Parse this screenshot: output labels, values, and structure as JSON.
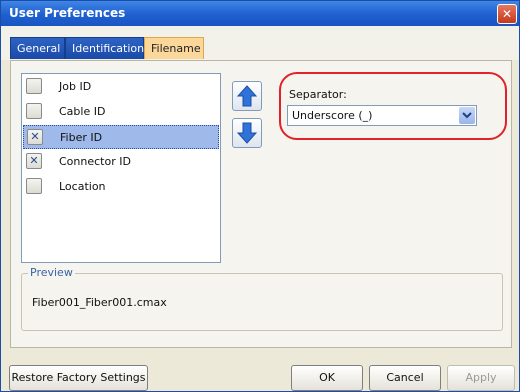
{
  "window": {
    "title": "User Preferences"
  },
  "tabs": [
    {
      "label": "General",
      "active": false
    },
    {
      "label": "Identification",
      "active": false
    },
    {
      "label": "Filename",
      "active": true
    }
  ],
  "field_list": {
    "items": [
      {
        "label": "Job ID",
        "checked": false,
        "selected": false
      },
      {
        "label": "Cable ID",
        "checked": false,
        "selected": false
      },
      {
        "label": "Fiber ID",
        "checked": true,
        "selected": true
      },
      {
        "label": "Connector ID",
        "checked": true,
        "selected": false
      },
      {
        "label": "Location",
        "checked": false,
        "selected": false
      }
    ],
    "move_up_icon": "arrow-up-icon",
    "move_down_icon": "arrow-down-icon"
  },
  "separator": {
    "label": "Separator:",
    "selected": "Underscore (_)"
  },
  "preview": {
    "legend": "Preview",
    "value": "Fiber001_Fiber001.cmax"
  },
  "buttons": {
    "restore": "Restore Factory Settings",
    "ok": "OK",
    "cancel": "Cancel",
    "apply": "Apply"
  },
  "colors": {
    "title_bar": "#1f5fcf",
    "active_tab": "#fbd79a",
    "highlight": "#e0222a",
    "selection": "#9fb9ea"
  }
}
